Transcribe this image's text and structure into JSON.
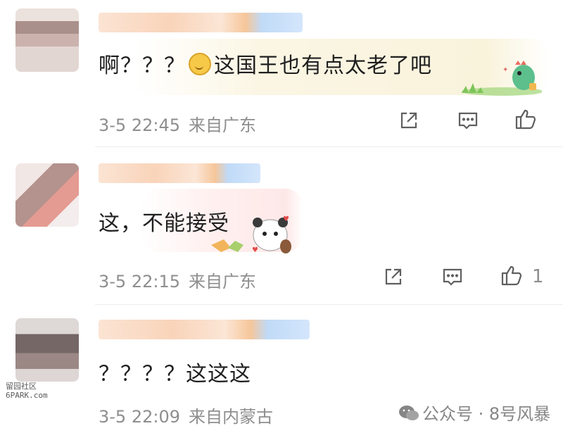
{
  "comments": [
    {
      "text_before": "啊？？？",
      "text_after": "这国王也有点太老了吧",
      "emoji": "grinning-face-emoji",
      "sticker": "green-dinosaur-sticker",
      "time": "3-5 22:45",
      "location": "来自广东",
      "likes": ""
    },
    {
      "text_before": "这，不能接受",
      "text_after": "",
      "emoji": "",
      "sticker": "panda-bear-sticker",
      "time": "3-5 22:15",
      "location": "来自广东",
      "likes": "1"
    },
    {
      "text_before": "？？？？这这这",
      "text_after": "",
      "emoji": "",
      "sticker": "",
      "time": "3-5 22:09",
      "location": "来自内蒙古",
      "likes": ""
    }
  ],
  "actions": {
    "share_icon": "share-icon",
    "comment_icon": "comment-icon",
    "like_icon": "thumbs-up-icon"
  },
  "watermarks": {
    "left_line1": "留园社区",
    "left_line2": "6PARK.com",
    "right": "公众号 · 8号风暴"
  },
  "colors": {
    "meta_text": "#8e8e8e",
    "bubble_tint": "#f9f3dc"
  }
}
